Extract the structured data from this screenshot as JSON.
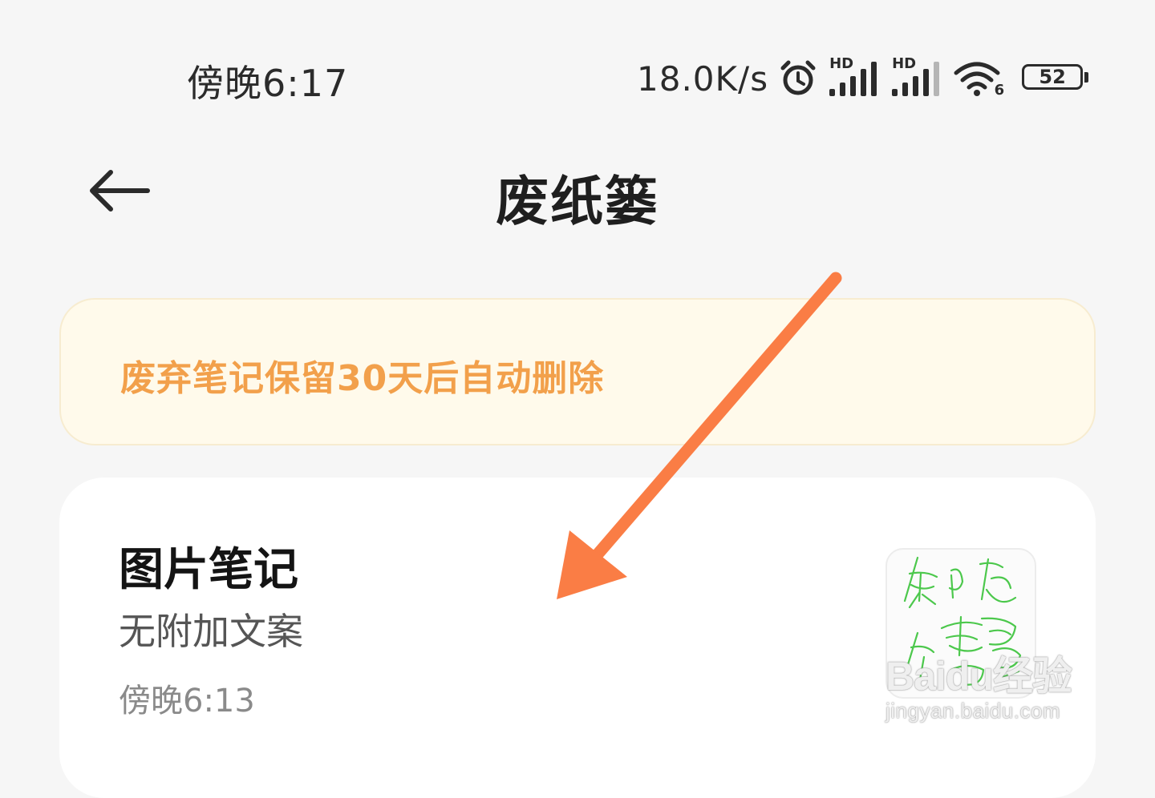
{
  "status_bar": {
    "time": "傍晚6:17",
    "net_speed": "18.0K/s",
    "signal_1_label": "HD",
    "signal_2_label": "HD",
    "wifi_label": "6",
    "battery_level": "52",
    "icons": [
      "alarm-icon",
      "signal-hd-icon",
      "signal-hd-icon",
      "wifi-6-icon",
      "battery-icon"
    ]
  },
  "header": {
    "back_icon": "arrow-left-icon",
    "title": "废纸篓"
  },
  "notice": {
    "text": "废弃笔记保留30天后自动删除",
    "color": "#f2a04b"
  },
  "notes": [
    {
      "title": "图片笔记",
      "snippet": "无附加文案",
      "time": "傍晚6:13",
      "thumbnail": "handwritten-image"
    }
  ],
  "watermark": {
    "main": "Baidu经验",
    "sub": "jingyan.baidu.com"
  },
  "colors": {
    "background": "#f6f6f6",
    "notice_bg": "#fffaeb",
    "accent_orange": "#f2a04b",
    "annotation_arrow": "#fa7d45"
  }
}
